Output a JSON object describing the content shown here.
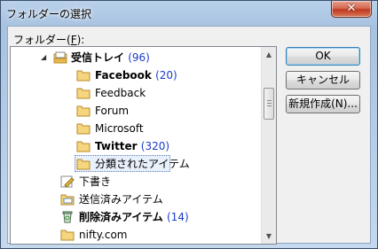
{
  "window": {
    "title": "フォルダーの選択",
    "close_glyph": "✕"
  },
  "label": {
    "prefix": "フォルダー(",
    "accel": "F",
    "suffix": "):"
  },
  "tree": {
    "items": [
      {
        "label": "受信トレイ",
        "count": "(96)",
        "bold": true,
        "icon": "inbox-icon",
        "expand": "◢"
      },
      {
        "label": "Facebook",
        "count": "(20)",
        "bold": true,
        "icon": "folder-icon"
      },
      {
        "label": "Feedback",
        "count": "",
        "bold": false,
        "icon": "folder-icon"
      },
      {
        "label": "Forum",
        "count": "",
        "bold": false,
        "icon": "folder-icon"
      },
      {
        "label": "Microsoft",
        "count": "",
        "bold": false,
        "icon": "folder-icon"
      },
      {
        "label": "Twitter",
        "count": "(320)",
        "bold": true,
        "icon": "folder-icon"
      },
      {
        "label": "分類されたアイテム",
        "count": "",
        "bold": false,
        "icon": "folder-icon",
        "selected": true
      },
      {
        "label": "下書き",
        "count": "",
        "bold": false,
        "icon": "drafts-icon"
      },
      {
        "label": "送信済みアイテム",
        "count": "",
        "bold": false,
        "icon": "sent-items-icon"
      },
      {
        "label": "削除済みアイテム",
        "count": "(14)",
        "bold": true,
        "icon": "deleted-items-icon"
      },
      {
        "label": "nifty.com",
        "count": "",
        "bold": false,
        "icon": "folder-icon"
      }
    ]
  },
  "buttons": {
    "ok": "OK",
    "cancel": "キャンセル",
    "new": "新規作成(N)..."
  },
  "scroll": {
    "up_glyph": "▲",
    "down_glyph": "▼"
  }
}
